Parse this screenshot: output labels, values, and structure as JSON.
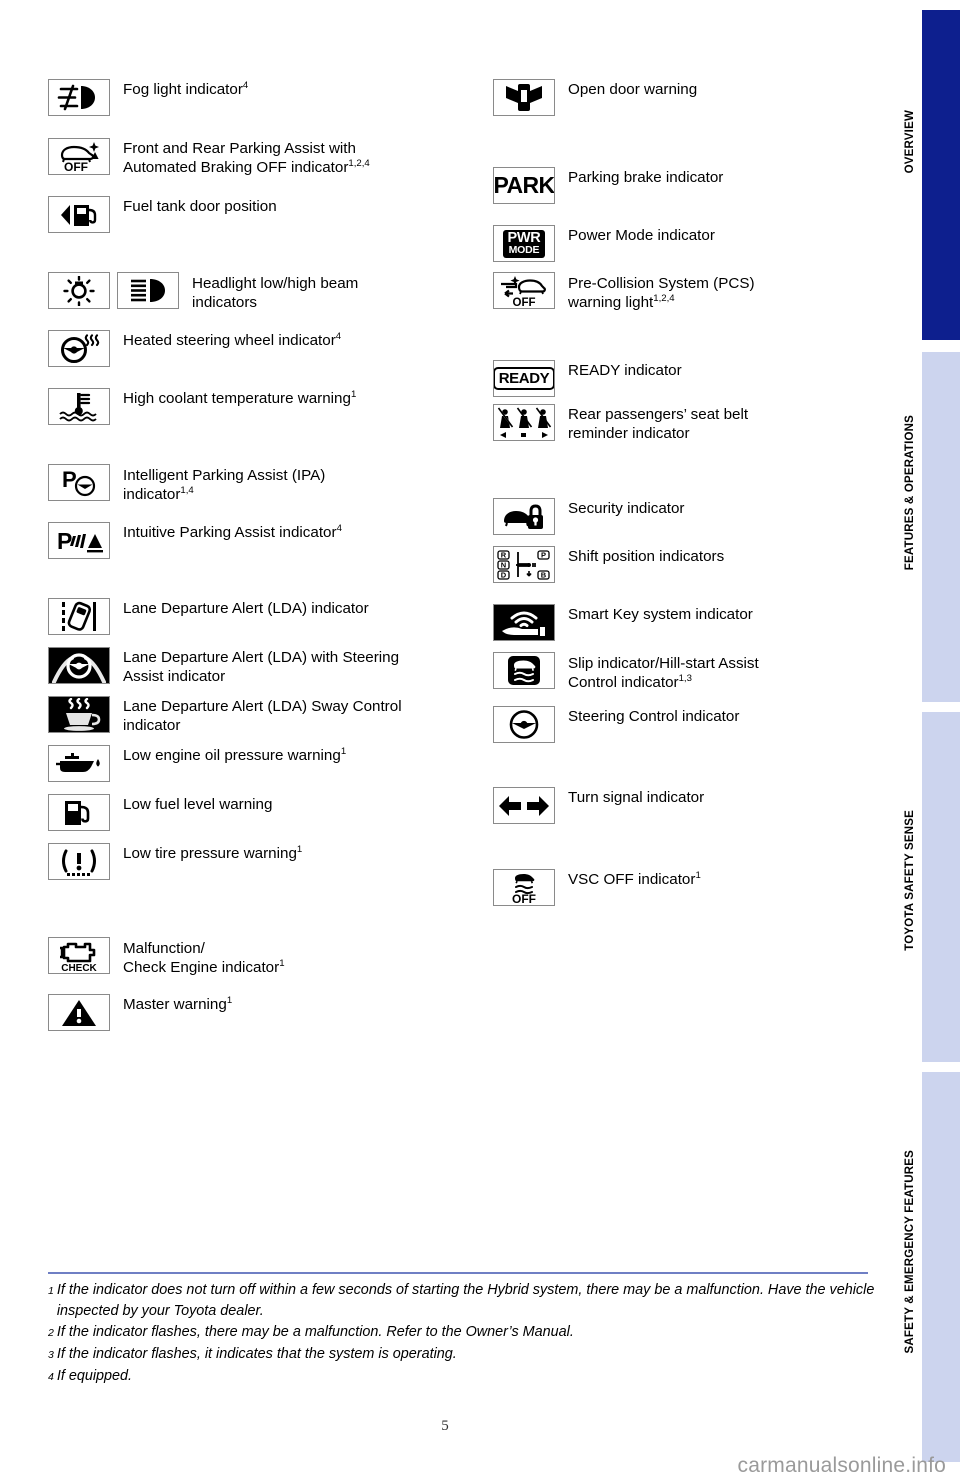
{
  "page": {
    "number": "5",
    "watermark": "carmanualsonline.info"
  },
  "tabs": [
    {
      "label": "OVERVIEW",
      "active": true
    },
    {
      "label": "FEATURES & OPERATIONS",
      "active": false
    },
    {
      "label": "TOYOTA SAFETY SENSE",
      "active": false
    },
    {
      "label": "SAFETY & EMERGENCY FEATURES",
      "active": false
    }
  ],
  "colors": {
    "tab_active": "#0d1f8e",
    "tab_inactive": "#ccd4ee",
    "rule": "#6f7fc4",
    "icon_border": "#8a8a8a"
  },
  "left_column": [
    {
      "icon": "fog-light-icon",
      "label": "Fog light indicator",
      "sup": "4"
    },
    {
      "icon": "front-rear-parking-assist-off-icon",
      "label": "Front and Rear Parking Assist with\nAutomated Braking OFF indicator",
      "sup": "1,2,4"
    },
    {
      "icon": "fuel-tank-door-position-icon",
      "label": "Fuel tank door position",
      "sup": ""
    },
    {
      "icon": "headlight-low-beam-icon",
      "icon2": "headlight-high-beam-icon",
      "label": "Headlight low/high beam\nindicators",
      "sup": ""
    },
    {
      "icon": "heated-steering-wheel-icon",
      "label": "Heated steering wheel indicator",
      "sup": "4"
    },
    {
      "icon": "high-coolant-temperature-icon",
      "label": "High coolant temperature warning",
      "sup": "1"
    },
    {
      "icon": "intelligent-parking-assist-icon",
      "label": "Intelligent Parking Assist (IPA)\nindicator",
      "sup": "1,4"
    },
    {
      "icon": "intuitive-parking-assist-icon",
      "label": "Intuitive Parking Assist indicator",
      "sup": "4"
    },
    {
      "icon": "lane-departure-alert-icon",
      "label": "Lane Departure Alert (LDA) indicator",
      "sup": ""
    },
    {
      "icon": "lane-departure-steering-assist-icon",
      "label": "Lane Departure Alert (LDA) with Steering\nAssist indicator",
      "sup": ""
    },
    {
      "icon": "lane-departure-sway-control-icon",
      "label": "Lane Departure Alert (LDA) Sway Control\nindicator",
      "sup": ""
    },
    {
      "icon": "low-engine-oil-pressure-icon",
      "label": "Low engine oil pressure warning",
      "sup": "1"
    },
    {
      "icon": "low-fuel-level-icon",
      "label": "Low fuel level warning",
      "sup": ""
    },
    {
      "icon": "low-tire-pressure-icon",
      "label": "Low tire pressure warning",
      "sup": "1"
    },
    {
      "icon": "malfunction-check-engine-icon",
      "label": "Malfunction/\nCheck Engine indicator",
      "sup": "1"
    },
    {
      "icon": "master-warning-icon",
      "label": "Master warning",
      "sup": "1"
    }
  ],
  "right_column": [
    {
      "icon": "open-door-warning-icon",
      "label": "Open door warning",
      "sup": ""
    },
    {
      "icon": "parking-brake-icon",
      "label": "Parking brake indicator",
      "sup": ""
    },
    {
      "icon": "power-mode-icon",
      "label": "Power Mode indicator",
      "sup": ""
    },
    {
      "icon": "pre-collision-system-off-icon",
      "label": "Pre-Collision System (PCS)\nwarning light",
      "sup": "1,2,4"
    },
    {
      "icon": "ready-indicator-icon",
      "label": "READY indicator",
      "sup": ""
    },
    {
      "icon": "rear-seat-belt-reminder-icon",
      "label": "Rear passengers’ seat belt\nreminder indicator",
      "sup": ""
    },
    {
      "icon": "security-indicator-icon",
      "label": "Security indicator",
      "sup": ""
    },
    {
      "icon": "shift-position-icon",
      "label": "Shift position indicators",
      "sup": ""
    },
    {
      "icon": "smart-key-system-icon",
      "label": "Smart Key system indicator",
      "sup": ""
    },
    {
      "icon": "slip-hill-start-assist-icon",
      "label": "Slip indicator/Hill-start Assist\nControl indicator",
      "sup": "1,3"
    },
    {
      "icon": "steering-control-icon",
      "label": "Steering Control indicator",
      "sup": ""
    },
    {
      "icon": "turn-signal-icon",
      "label": "Turn signal indicator",
      "sup": ""
    },
    {
      "icon": "vsc-off-icon",
      "label": "VSC OFF indicator",
      "sup": "1"
    }
  ],
  "icon_text": {
    "park": "PARK",
    "pwr_line1": "PWR",
    "pwr_line2": "MODE",
    "ready": "READY",
    "off": "OFF",
    "check": "CHECK"
  },
  "footnotes": [
    {
      "mark": "1",
      "text": "If the indicator does not turn off within a few seconds of starting the Hybrid system, there may be a malfunction. Have the vehicle inspected by your Toyota dealer."
    },
    {
      "mark": "2",
      "text": "If the indicator flashes, there may be a malfunction. Refer to the Owner’s Manual."
    },
    {
      "mark": "3",
      "text": "If the indicator flashes, it indicates that the system is operating."
    },
    {
      "mark": "4",
      "text": "If equipped."
    }
  ]
}
